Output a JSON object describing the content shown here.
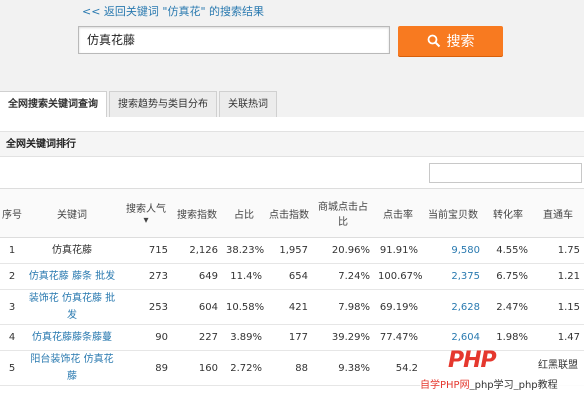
{
  "header": {
    "back_link": "<< 返回关键词 \"仿真花\" 的搜索结果",
    "search_value": "仿真花藤",
    "search_button": "搜索",
    "search_icon": "search-icon"
  },
  "tabs": [
    {
      "label": "全网搜索关键词查询",
      "active": true
    },
    {
      "label": "搜索趋势与类目分布",
      "active": false
    },
    {
      "label": "关联热词",
      "active": false
    }
  ],
  "section": {
    "title": "全网关键词排行"
  },
  "table": {
    "headers": [
      "序号",
      "关键词",
      "搜索人气 ▾",
      "搜索指数",
      "占比",
      "点击指数",
      "商城点击占比",
      "点击率",
      "当前宝贝数",
      "转化率",
      "直通车"
    ],
    "rows": [
      [
        "1",
        "仿真花藤",
        "715",
        "2,126",
        "38.23%",
        "1,957",
        "20.96%",
        "91.91%",
        "9,580",
        "4.55%",
        "1.75"
      ],
      [
        "2",
        "仿真花藤 藤条 批发",
        "273",
        "649",
        "11.4%",
        "654",
        "7.24%",
        "100.67%",
        "2,375",
        "6.75%",
        "1.21"
      ],
      [
        "3",
        "装饰花 仿真花藤 批发",
        "253",
        "604",
        "10.58%",
        "421",
        "7.98%",
        "69.19%",
        "2,628",
        "2.47%",
        "1.15"
      ],
      [
        "4",
        "仿真花藤藤条藤蔓",
        "90",
        "227",
        "3.89%",
        "177",
        "39.29%",
        "77.47%",
        "2,604",
        "1.98%",
        "1.47"
      ],
      [
        "5",
        "阳台装饰花 仿真花藤",
        "89",
        "160",
        "2.72%",
        "88",
        "9.38%",
        "54.2",
        "",
        "",
        ""
      ]
    ]
  },
  "watermark": {
    "logo": "PHP",
    "brand": "红黑联盟",
    "line_red": "自学PHP网",
    "line_rest": "_php学习_php教程"
  },
  "colors": {
    "accent": "#f87a20",
    "link": "#2a7ab0"
  }
}
